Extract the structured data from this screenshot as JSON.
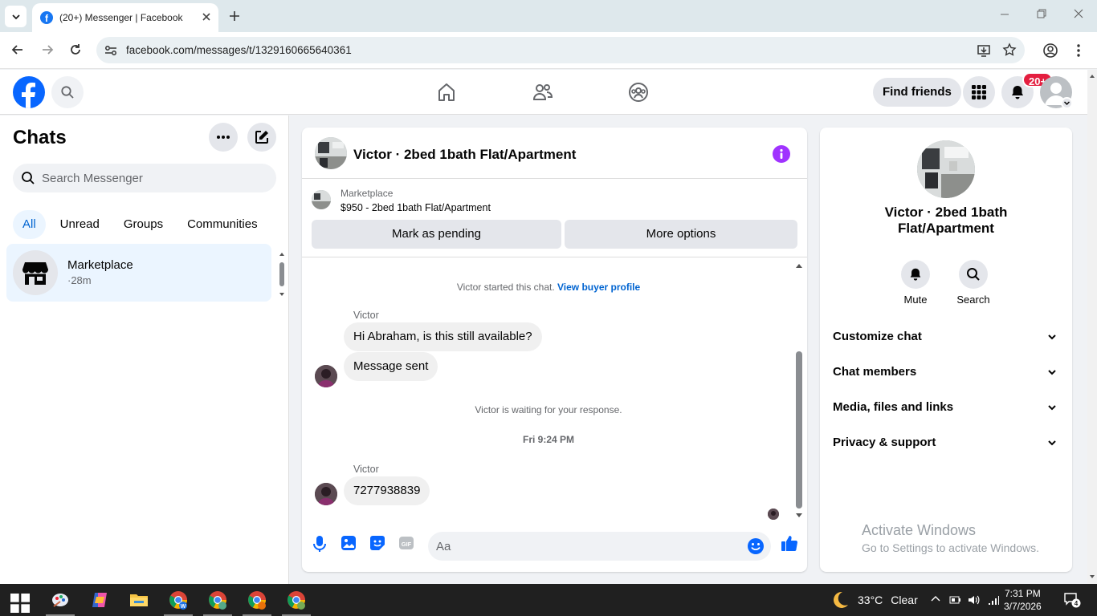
{
  "browser": {
    "tab_title": "(20+) Messenger | Facebook",
    "url": "facebook.com/messages/t/1329160665640361"
  },
  "header": {
    "find_friends": "Find friends",
    "notif_badge": "20+"
  },
  "sidebar": {
    "title": "Chats",
    "search_placeholder": "Search Messenger",
    "filters": [
      "All",
      "Unread",
      "Groups",
      "Communities"
    ],
    "active_filter": "All",
    "chats": [
      {
        "name": "Marketplace",
        "time": "·28m"
      }
    ]
  },
  "conversation": {
    "title": "Victor · 2bed 1bath Flat/Apartment",
    "marketplace_label": "Marketplace",
    "listing": "$950 - 2bed 1bath Flat/Apartment",
    "mark_pending": "Mark as pending",
    "more_options": "More options",
    "started_text": "Victor started this chat.",
    "buyer_profile_link": "View buyer profile",
    "sender1": "Victor",
    "msg1": "Hi Abraham, is this still available?",
    "msg2": "Message sent",
    "waiting_text": "Victor is waiting for your response.",
    "timestamp": "Fri 9:24 PM",
    "sender2": "Victor",
    "msg3": "7277938839",
    "input_placeholder": "Aa"
  },
  "right_panel": {
    "name_line1": "Victor · 2bed 1bath",
    "name_line2": "Flat/Apartment",
    "mute": "Mute",
    "search": "Search",
    "sections": [
      "Customize chat",
      "Chat members",
      "Media, files and links",
      "Privacy & support"
    ],
    "watermark_title": "Activate Windows",
    "watermark_sub": "Go to Settings to activate Windows."
  },
  "taskbar": {
    "temperature": "33°C",
    "weather": "Clear",
    "time": "7:31 PM",
    "date": "3/7/2026",
    "notification_count": "4"
  }
}
